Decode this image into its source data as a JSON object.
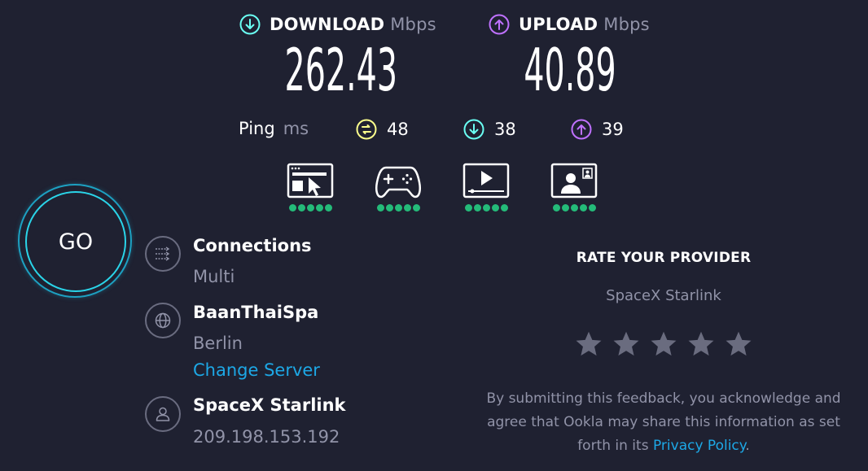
{
  "download": {
    "label": "DOWNLOAD",
    "unit": "Mbps",
    "value": "262.43"
  },
  "upload": {
    "label": "UPLOAD",
    "unit": "Mbps",
    "value": "40.89"
  },
  "ping": {
    "label": "Ping",
    "unit": "ms",
    "idle": "48",
    "download": "38",
    "upload": "39"
  },
  "quality": [
    {
      "icon": "web-browsing-icon",
      "rating": 5
    },
    {
      "icon": "gaming-controller-icon",
      "rating": 5
    },
    {
      "icon": "video-streaming-icon",
      "rating": 5
    },
    {
      "icon": "video-chat-icon",
      "rating": 5
    }
  ],
  "go_label": "GO",
  "connections": {
    "title": "Connections",
    "value": "Multi"
  },
  "server": {
    "name": "BaanThaiSpa",
    "location": "Berlin",
    "change_label": "Change Server"
  },
  "provider": {
    "name": "SpaceX Starlink",
    "ip": "209.198.153.192"
  },
  "rate": {
    "title": "RATE YOUR PROVIDER",
    "provider": "SpaceX Starlink",
    "stars": 5,
    "disclaimer_1": "By submitting this feedback, you acknowledge and",
    "disclaimer_2": "agree that Ookla may share this information as set",
    "disclaimer_3": "forth in its",
    "privacy_link": "Privacy Policy",
    "disclaimer_end": "."
  },
  "colors": {
    "background": "#1f2131",
    "download_accent": "#6afff3",
    "upload_accent": "#bf71ff",
    "idle_ping_accent": "#fbfe8c",
    "quality_good": "#24bb79",
    "link": "#1da8e6",
    "go_ring": "#2ad4e8"
  }
}
